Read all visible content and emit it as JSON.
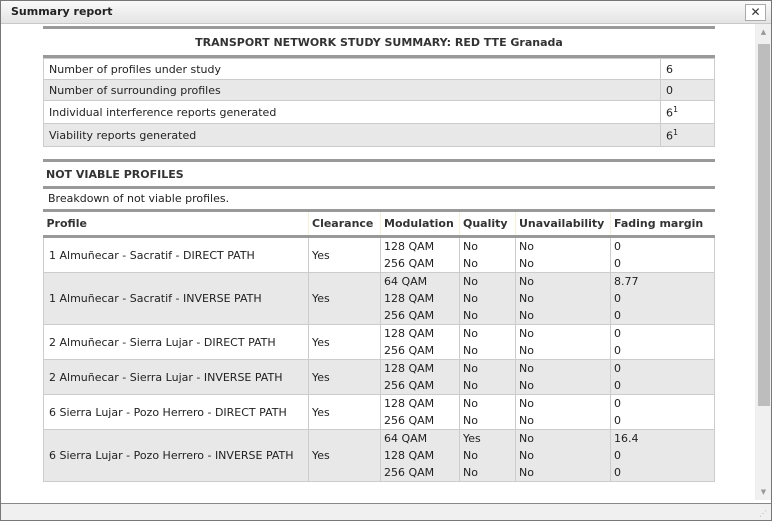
{
  "window": {
    "title": "Summary report",
    "close_label": "✕"
  },
  "report": {
    "title": "TRANSPORT NETWORK STUDY SUMMARY: RED TTE Granada",
    "summary": [
      {
        "label": "Number of profiles under study",
        "value": "6",
        "sup": ""
      },
      {
        "label": "Number of surrounding profiles",
        "value": "0",
        "sup": ""
      },
      {
        "label": "Individual interference reports generated",
        "value": "6",
        "sup": "1"
      },
      {
        "label": "Viability reports generated",
        "value": "6",
        "sup": "1"
      }
    ],
    "section_title": "NOT VIABLE PROFILES",
    "section_desc": "Breakdown of not viable profiles.",
    "columns": [
      "Profile",
      "Clearance",
      "Modulation",
      "Quality",
      "Unavailability",
      "Fading margin"
    ],
    "rows": [
      {
        "profile": "1 Almuñecar - Sacratif - DIRECT PATH",
        "clearance": "Yes",
        "lines": [
          [
            "128 QAM",
            "No",
            "No",
            "0"
          ],
          [
            "256 QAM",
            "No",
            "No",
            "0"
          ]
        ]
      },
      {
        "profile": "1 Almuñecar - Sacratif - INVERSE PATH",
        "clearance": "Yes",
        "lines": [
          [
            "64 QAM",
            "No",
            "No",
            "8.77"
          ],
          [
            "128 QAM",
            "No",
            "No",
            "0"
          ],
          [
            "256 QAM",
            "No",
            "No",
            "0"
          ]
        ]
      },
      {
        "profile": "2 Almuñecar - Sierra Lujar - DIRECT PATH",
        "clearance": "Yes",
        "lines": [
          [
            "128 QAM",
            "No",
            "No",
            "0"
          ],
          [
            "256 QAM",
            "No",
            "No",
            "0"
          ]
        ]
      },
      {
        "profile": "2 Almuñecar - Sierra Lujar - INVERSE PATH",
        "clearance": "Yes",
        "lines": [
          [
            "128 QAM",
            "No",
            "No",
            "0"
          ],
          [
            "256 QAM",
            "No",
            "No",
            "0"
          ]
        ]
      },
      {
        "profile": "6 Sierra Lujar - Pozo Herrero - DIRECT PATH",
        "clearance": "Yes",
        "lines": [
          [
            "128 QAM",
            "No",
            "No",
            "0"
          ],
          [
            "256 QAM",
            "No",
            "No",
            "0"
          ]
        ]
      },
      {
        "profile": "6 Sierra Lujar - Pozo Herrero - INVERSE PATH",
        "clearance": "Yes",
        "lines": [
          [
            "64 QAM",
            "Yes",
            "No",
            "16.4"
          ],
          [
            "128 QAM",
            "No",
            "No",
            "0"
          ],
          [
            "256 QAM",
            "No",
            "No",
            "0"
          ]
        ]
      }
    ]
  },
  "icons": {
    "close": "close-icon",
    "scroll_up": "scroll-up-arrow-icon",
    "scroll_down": "scroll-down-arrow-icon",
    "resize": "resize-grip-icon"
  }
}
